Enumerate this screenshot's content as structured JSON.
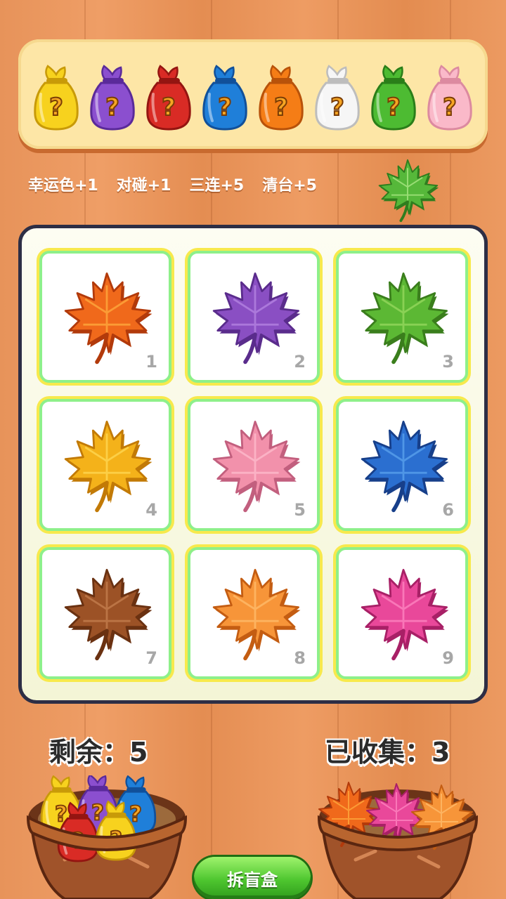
{
  "bag_bar": {
    "bags": [
      {
        "color": "#f7d21e",
        "dark": "#c89a08",
        "icon": "mystery-bag-yellow-icon"
      },
      {
        "color": "#8b4fcf",
        "dark": "#5a2a9a",
        "icon": "mystery-bag-purple-icon"
      },
      {
        "color": "#d92b25",
        "dark": "#941511",
        "icon": "mystery-bag-red-icon"
      },
      {
        "color": "#1f7fd9",
        "dark": "#11509a",
        "icon": "mystery-bag-blue-icon"
      },
      {
        "color": "#f57d16",
        "dark": "#b8520a",
        "icon": "mystery-bag-orange-icon"
      },
      {
        "color": "#f6f6f6",
        "dark": "#bdbdbd",
        "icon": "mystery-bag-white-icon"
      },
      {
        "color": "#4dbb32",
        "dark": "#2a7e19",
        "icon": "mystery-bag-green-icon"
      },
      {
        "color": "#fab9c9",
        "dark": "#dc8aa0",
        "icon": "mystery-bag-pink-icon"
      }
    ],
    "question_mark": "?"
  },
  "tips": {
    "lucky": "幸运色+1",
    "pair": "对碰+1",
    "triple": "三连+5",
    "clear": "清台+5"
  },
  "lucky_color": {
    "color": "#56b83a",
    "dark": "#2f7d1e",
    "icon": "lucky-leaf-green-icon"
  },
  "grid": {
    "cells": [
      {
        "num": "1",
        "color": "#f0691b",
        "dark": "#b23a0b",
        "light": "#ffb040"
      },
      {
        "num": "2",
        "color": "#8a4fc3",
        "dark": "#5a2c8c",
        "light": "#b98ae6"
      },
      {
        "num": "3",
        "color": "#5cb834",
        "dark": "#3a7e1c",
        "light": "#9ddb62"
      },
      {
        "num": "4",
        "color": "#f4b21a",
        "dark": "#c27a06",
        "light": "#ffdc5a"
      },
      {
        "num": "5",
        "color": "#f291ab",
        "dark": "#c25f7e",
        "light": "#ffc1d0"
      },
      {
        "num": "6",
        "color": "#2b6fd0",
        "dark": "#173f8a",
        "light": "#5fa7f0"
      },
      {
        "num": "7",
        "color": "#9c5226",
        "dark": "#6a3111",
        "light": "#c98352"
      },
      {
        "num": "8",
        "color": "#f79539",
        "dark": "#c45d12",
        "light": "#ffc070"
      },
      {
        "num": "9",
        "color": "#e9489a",
        "dark": "#a82066",
        "light": "#ff8cc4"
      }
    ]
  },
  "counters": {
    "remaining": "剩余：5",
    "collected": "已收集：3"
  },
  "remaining_pot": {
    "bags": [
      {
        "color": "#f7d21e",
        "dark": "#c89a08"
      },
      {
        "color": "#8b4fcf",
        "dark": "#5a2a9a"
      },
      {
        "color": "#1f7fd9",
        "dark": "#11509a"
      },
      {
        "color": "#d92b25",
        "dark": "#941511"
      },
      {
        "color": "#f7d21e",
        "dark": "#c89a08"
      }
    ]
  },
  "collected_pot": {
    "leaves": [
      {
        "color": "#f0691b",
        "dark": "#b23a0b",
        "light": "#ffb040"
      },
      {
        "color": "#e9489a",
        "dark": "#a82066",
        "light": "#ff8cc4"
      },
      {
        "color": "#f79539",
        "dark": "#c45d12",
        "light": "#ffc070"
      }
    ]
  },
  "open_button": {
    "label": "拆盲盒"
  }
}
